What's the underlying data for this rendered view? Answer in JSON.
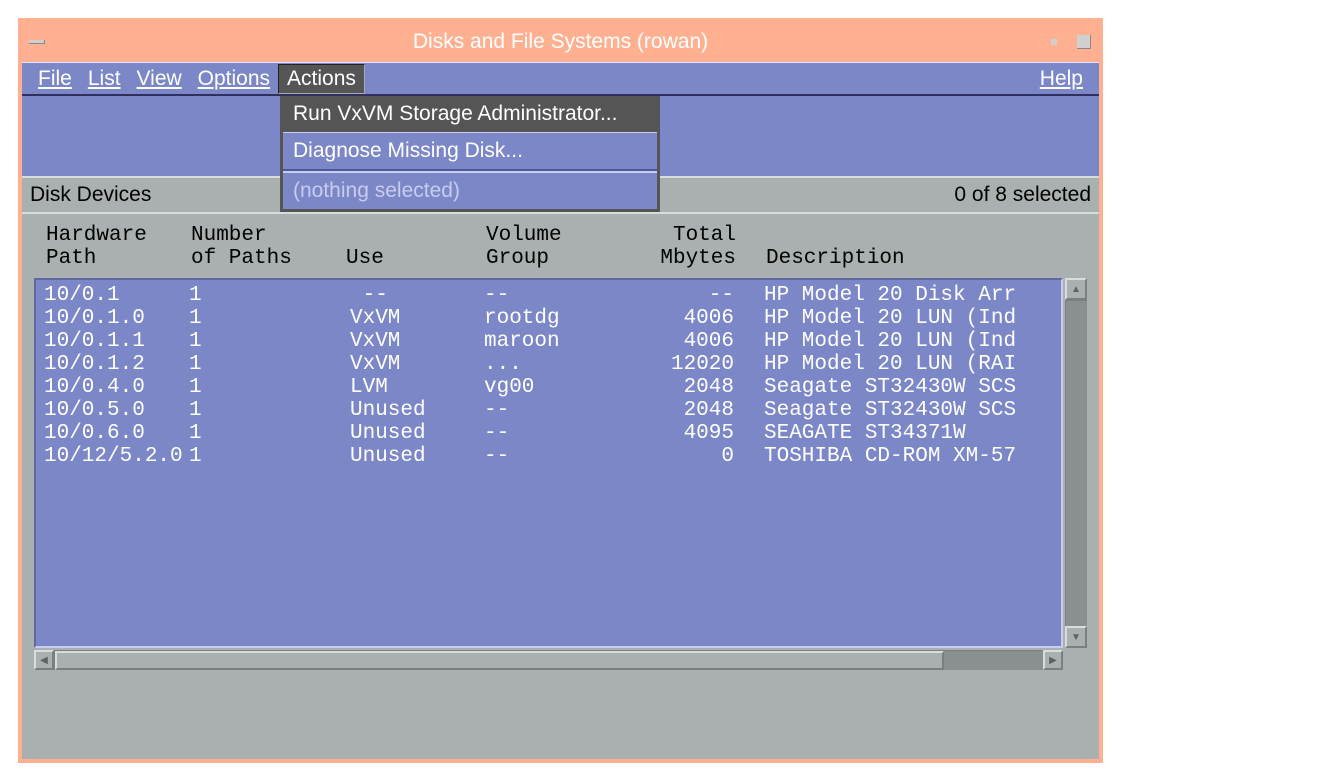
{
  "title": "Disks and File Systems (rowan)",
  "menu": {
    "file": "File",
    "list": "List",
    "view": "View",
    "options": "Options",
    "actions": "Actions",
    "help": "Help"
  },
  "dropdown": {
    "item1": "Run VxVM Storage Administrator...",
    "item2": "Diagnose Missing Disk...",
    "disabled": "(nothing selected)"
  },
  "section": {
    "label": "Disk Devices",
    "status": "0 of 8 selected"
  },
  "columns": {
    "hw_path_l1": "Hardware",
    "hw_path_l2": "Path",
    "num_l1": "Number",
    "num_l2": "of Paths",
    "use": "Use",
    "vg_l1": "Volume",
    "vg_l2": "Group",
    "total_l1": "Total",
    "total_l2": "Mbytes",
    "desc": "Description"
  },
  "rows": [
    {
      "path": "10/0.1",
      "paths": "1",
      "use": " --",
      "vg": "--",
      "mb": "--",
      "desc": "HP Model 20 Disk Arr"
    },
    {
      "path": "10/0.1.0",
      "paths": "1",
      "use": "VxVM",
      "vg": "rootdg",
      "mb": "4006",
      "desc": "HP Model 20 LUN (Ind"
    },
    {
      "path": "10/0.1.1",
      "paths": "1",
      "use": "VxVM",
      "vg": "maroon",
      "mb": "4006",
      "desc": "HP Model 20 LUN (Ind"
    },
    {
      "path": "10/0.1.2",
      "paths": "1",
      "use": "VxVM",
      "vg": "...",
      "mb": "12020",
      "desc": "HP Model 20 LUN (RAI"
    },
    {
      "path": "10/0.4.0",
      "paths": "1",
      "use": "LVM",
      "vg": "vg00",
      "mb": "2048",
      "desc": "Seagate ST32430W SCS"
    },
    {
      "path": "10/0.5.0",
      "paths": "1",
      "use": "Unused",
      "vg": "--",
      "mb": "2048",
      "desc": "Seagate ST32430W SCS"
    },
    {
      "path": "10/0.6.0",
      "paths": "1",
      "use": "Unused",
      "vg": "--",
      "mb": "4095",
      "desc": "SEAGATE ST34371W"
    },
    {
      "path": "10/12/5.2.0",
      "paths": "1",
      "use": "Unused",
      "vg": "--",
      "mb": "0",
      "desc": "TOSHIBA CD-ROM XM-57"
    }
  ]
}
